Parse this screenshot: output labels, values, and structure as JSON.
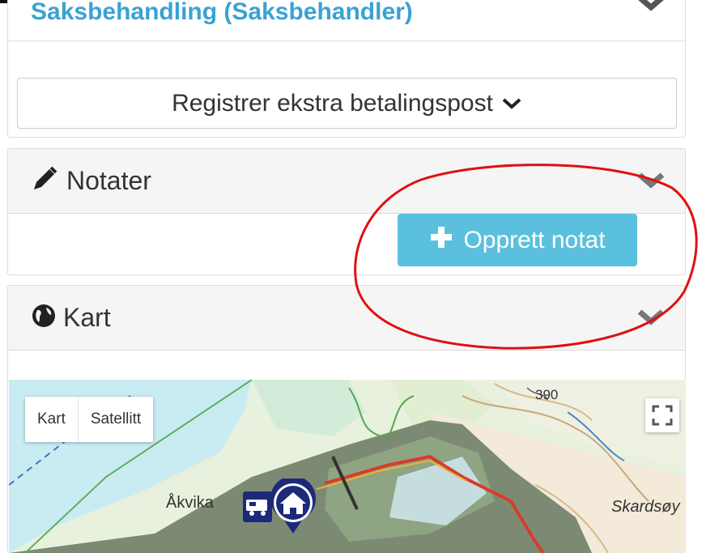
{
  "panels": {
    "case": {
      "title": "Saksbehandling (Saksbehandler)",
      "dropdown_label": "Registrer ekstra betalingspost"
    },
    "notes": {
      "title": "Notater",
      "button_label": "Opprett notat"
    },
    "map": {
      "title": "Kart",
      "toggle": [
        "Kart",
        "Satellitt"
      ],
      "labels": {
        "elevation": "390",
        "place_left": "Åkvika",
        "place_right": "Skardsøy"
      }
    }
  },
  "icons": [
    "pencil-icon",
    "globe-icon",
    "plus-icon",
    "chevron-down-icon",
    "fullscreen-icon",
    "home-marker-icon",
    "camper-icon"
  ],
  "colors": {
    "accent": "#3aa2d2",
    "primary_button": "#5bc0de",
    "annotation_red": "#e01010"
  }
}
